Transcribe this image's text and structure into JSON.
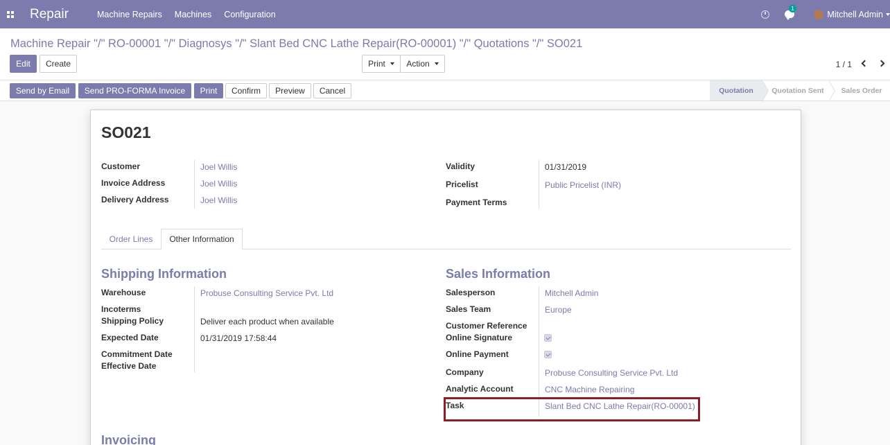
{
  "navbar": {
    "brand": "Repair",
    "menu": [
      "Machine Repairs",
      "Machines",
      "Configuration"
    ],
    "chat_count": "1",
    "user": "Mitchell Admin"
  },
  "breadcrumb": "Machine Repair \"/\" RO-00001 \"/\" Diagnosys \"/\" Slant Bed CNC Lathe Repair(RO-00001) \"/\" Quotations \"/\" SO021",
  "toolbar": {
    "edit": "Edit",
    "create": "Create",
    "print": "Print",
    "action": "Action",
    "pager": "1 / 1"
  },
  "statusbar": {
    "buttons": [
      "Send by Email",
      "Send PRO-FORMA Invoice",
      "Print",
      "Confirm",
      "Preview",
      "Cancel"
    ],
    "stages": [
      "Quotation",
      "Quotation Sent",
      "Sales Order"
    ]
  },
  "form": {
    "title": "SO021",
    "customer_label": "Customer",
    "customer": "Joel Willis",
    "invoice_address_label": "Invoice Address",
    "invoice_address": "Joel Willis",
    "delivery_address_label": "Delivery Address",
    "delivery_address": "Joel Willis",
    "validity_label": "Validity",
    "validity": "01/31/2019",
    "pricelist_label": "Pricelist",
    "pricelist": "Public Pricelist (INR)",
    "payment_terms_label": "Payment Terms",
    "tabs": [
      "Order Lines",
      "Other Information"
    ],
    "shipping": {
      "title": "Shipping Information",
      "warehouse_label": "Warehouse",
      "warehouse": "Probuse Consulting Service Pvt. Ltd",
      "incoterms_label": "Incoterms",
      "shipping_policy_label": "Shipping Policy",
      "shipping_policy": "Deliver each product when available",
      "expected_date_label": "Expected Date",
      "expected_date": "01/31/2019 17:58:44",
      "commitment_date_label": "Commitment Date",
      "effective_date_label": "Effective Date"
    },
    "sales": {
      "title": "Sales Information",
      "salesperson_label": "Salesperson",
      "salesperson": "Mitchell Admin",
      "sales_team_label": "Sales Team",
      "sales_team": "Europe",
      "customer_reference_label": "Customer Reference",
      "online_signature_label": "Online Signature",
      "online_signature_checked": true,
      "online_payment_label": "Online Payment",
      "online_payment_checked": true,
      "company_label": "Company",
      "company": "Probuse Consulting Service Pvt. Ltd",
      "analytic_account_label": "Analytic Account",
      "analytic_account": "CNC Machine Repairing",
      "task_label": "Task",
      "task": "Slant Bed CNC Lathe Repair(RO-00001)"
    },
    "invoicing_title": "Invoicing"
  },
  "colors": {
    "brand": "#7c7bad",
    "highlight": "#8b1e24"
  }
}
